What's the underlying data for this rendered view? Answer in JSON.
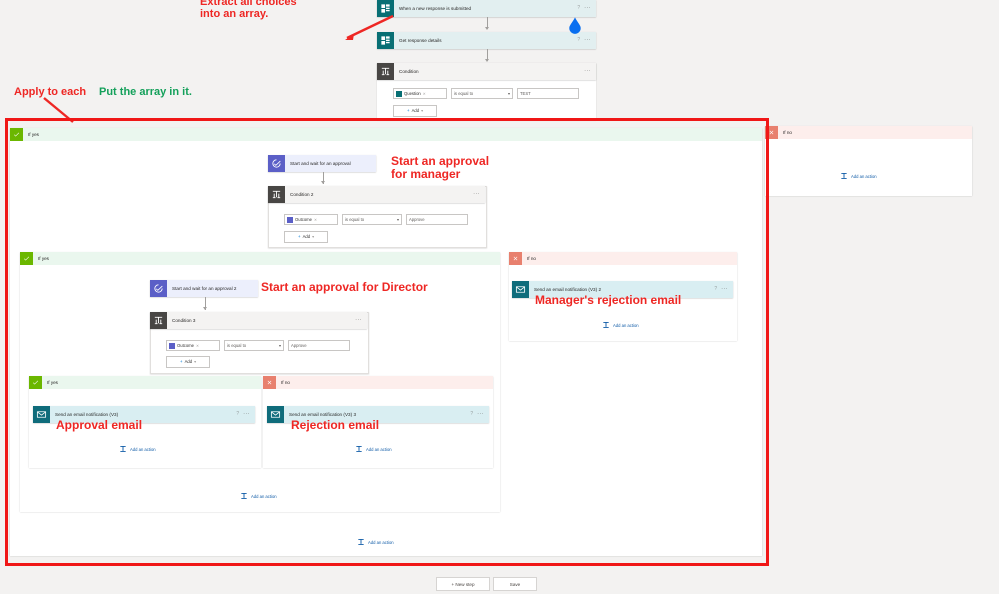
{
  "app": {
    "name": "Power Automate flow designer",
    "canvas_background": "#f3f2f1"
  },
  "colors": {
    "annotation_red": "#ee2724",
    "annotation_green": "#13a05a",
    "highlight_box_red": "#f01717",
    "branch_yes_green": "#6bb700",
    "branch_no_red": "#e8806e",
    "forms_teal": "#086f74",
    "approval_purple": "#5b5fc7",
    "mail_teal": "#0f6c7b",
    "link_blue": "#0f5ba7"
  },
  "annotations": [
    {
      "id": "extract-choices",
      "text": "Extract all choices\ninto an array.",
      "color": "red"
    },
    {
      "id": "apply-to-each",
      "text": "Apply to each",
      "color": "red"
    },
    {
      "id": "put-array",
      "text": "Put the array in it.",
      "color": "green"
    },
    {
      "id": "approval-manager",
      "text": "Start an approval\nfor manager",
      "color": "red"
    },
    {
      "id": "approval-director",
      "text": "Start an approval for Director",
      "color": "red"
    },
    {
      "id": "managers-rejection",
      "text": "Manager's rejection email",
      "color": "red"
    },
    {
      "id": "approval-email",
      "text": "Approval email",
      "color": "red"
    },
    {
      "id": "rejection-email",
      "text": "Rejection email",
      "color": "red"
    }
  ],
  "flow": {
    "trigger": {
      "title": "When a new response is submitted",
      "icon": "microsoft-forms-icon",
      "help": "?",
      "menu": "···"
    },
    "get_response": {
      "title": "Get response details",
      "icon": "microsoft-forms-icon",
      "help": "?",
      "menu": "···"
    },
    "condition_1": {
      "title": "Condition",
      "icon": "condition-icon",
      "menu": "···",
      "left_token": "Question",
      "operator": "is equal to",
      "right_value": "TEST",
      "add_label": "Add"
    },
    "condition_2": {
      "title": "Condition 2",
      "icon": "condition-icon",
      "menu": "···",
      "left_token": "Outcome",
      "operator": "is equal to",
      "right_value": "Approve",
      "add_label": "Add"
    },
    "condition_3": {
      "title": "Condition 3",
      "icon": "condition-icon",
      "menu": "···",
      "left_token": "Outcome",
      "operator": "is equal to",
      "right_value": "Approve",
      "add_label": "Add"
    },
    "approval_1": {
      "title": "Start and wait for an approval",
      "icon": "approvals-icon"
    },
    "approval_2": {
      "title": "Start and wait for an approval 2",
      "icon": "approvals-icon"
    },
    "email_manager_reject": {
      "title": "Send an email notification (V3) 2",
      "icon": "mail-icon",
      "help": "?",
      "menu": "···"
    },
    "email_approval": {
      "title": "Send an email notification (V3)",
      "icon": "mail-icon",
      "help": "?",
      "menu": "···"
    },
    "email_reject": {
      "title": "Send an email notification (V3) 3",
      "icon": "mail-icon",
      "help": "?",
      "menu": "···"
    }
  },
  "branches": {
    "outer_yes": {
      "label": "If yes",
      "badge": "check-icon"
    },
    "outer_no": {
      "label": "If no",
      "badge": "cross-icon"
    },
    "mid_yes": {
      "label": "If yes",
      "badge": "check-icon"
    },
    "mid_no": {
      "label": "If no",
      "badge": "cross-icon"
    },
    "inner_yes": {
      "label": "If yes",
      "badge": "check-icon"
    },
    "inner_no": {
      "label": "If no",
      "badge": "cross-icon"
    }
  },
  "add_actions": {
    "label": "Add an action",
    "icon": "add-action-icon",
    "instances": [
      "outer-no",
      "manager-reject",
      "approval",
      "reject",
      "mid-yes",
      "outer-yes"
    ]
  },
  "bottom_bar": {
    "new_step": "+ New step",
    "save": "Save"
  },
  "cursor": {
    "shape": "blue-teardrop-pointer",
    "color": "#0a6ff0"
  }
}
